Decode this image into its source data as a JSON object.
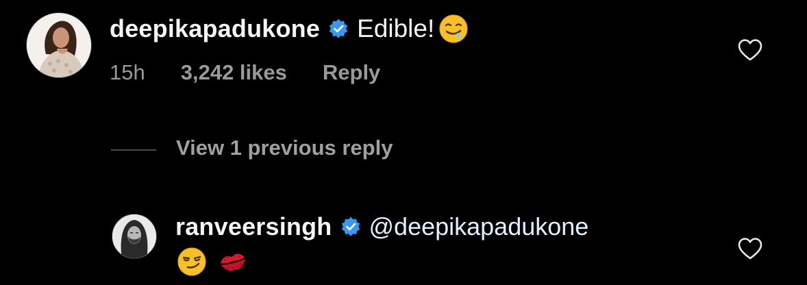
{
  "comment": {
    "username": "deepikapadukone",
    "verified": true,
    "text": "Edible!",
    "emoji": "drooling-face",
    "time": "15h",
    "likes": "3,242 likes",
    "reply_label": "Reply"
  },
  "thread": {
    "view_replies_label": "View 1 previous reply"
  },
  "reply": {
    "username": "ranveersingh",
    "verified": true,
    "mention": "@deepikapadukone",
    "emojis": [
      "smirking-face",
      "kiss-mark"
    ]
  },
  "colors": {
    "background": "#000000",
    "text": "#f5f5f5",
    "muted": "#9a9a9a",
    "verified_badge": "#3897f0"
  }
}
